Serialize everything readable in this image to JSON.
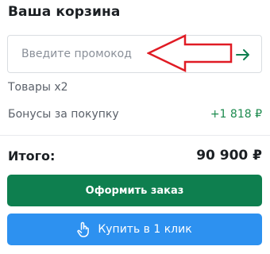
{
  "cart": {
    "title": "Ваша корзина",
    "promo": {
      "placeholder": "Введите промокод",
      "value": "",
      "submit_icon": "arrow-right-icon"
    },
    "goods_label": "Товары x2",
    "bonus_label": "Бонусы за покупку",
    "bonus_value": "+1 818 ₽",
    "total_label": "Итого:",
    "total_value": "90 900 ₽",
    "order_button": "Оформить заказ",
    "one_click_button": "Купить в 1 клик",
    "one_click_icon": "hand-pointer-icon"
  },
  "colors": {
    "accent_green": "#0e7f4f",
    "bonus_green": "#1b8a4d",
    "button_blue": "#2d91f0",
    "annotation_red": "#e01b24"
  }
}
